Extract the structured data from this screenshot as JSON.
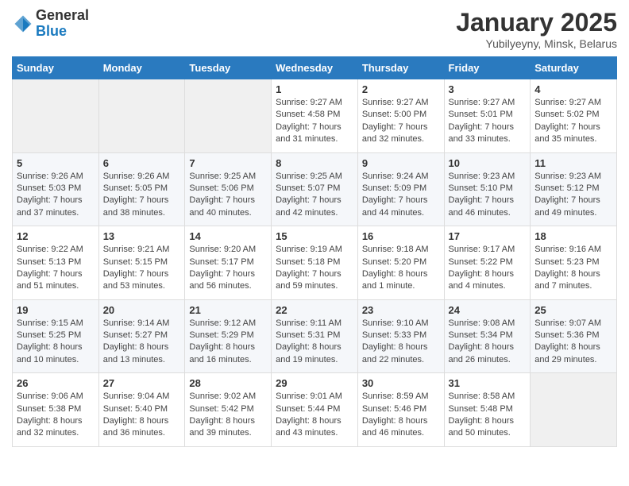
{
  "logo": {
    "general": "General",
    "blue": "Blue"
  },
  "header": {
    "title": "January 2025",
    "subtitle": "Yubilyeyny, Minsk, Belarus"
  },
  "weekdays": [
    "Sunday",
    "Monday",
    "Tuesday",
    "Wednesday",
    "Thursday",
    "Friday",
    "Saturday"
  ],
  "weeks": [
    [
      {
        "day": "",
        "content": ""
      },
      {
        "day": "",
        "content": ""
      },
      {
        "day": "",
        "content": ""
      },
      {
        "day": "1",
        "content": "Sunrise: 9:27 AM\nSunset: 4:58 PM\nDaylight: 7 hours and 31 minutes."
      },
      {
        "day": "2",
        "content": "Sunrise: 9:27 AM\nSunset: 5:00 PM\nDaylight: 7 hours and 32 minutes."
      },
      {
        "day": "3",
        "content": "Sunrise: 9:27 AM\nSunset: 5:01 PM\nDaylight: 7 hours and 33 minutes."
      },
      {
        "day": "4",
        "content": "Sunrise: 9:27 AM\nSunset: 5:02 PM\nDaylight: 7 hours and 35 minutes."
      }
    ],
    [
      {
        "day": "5",
        "content": "Sunrise: 9:26 AM\nSunset: 5:03 PM\nDaylight: 7 hours and 37 minutes."
      },
      {
        "day": "6",
        "content": "Sunrise: 9:26 AM\nSunset: 5:05 PM\nDaylight: 7 hours and 38 minutes."
      },
      {
        "day": "7",
        "content": "Sunrise: 9:25 AM\nSunset: 5:06 PM\nDaylight: 7 hours and 40 minutes."
      },
      {
        "day": "8",
        "content": "Sunrise: 9:25 AM\nSunset: 5:07 PM\nDaylight: 7 hours and 42 minutes."
      },
      {
        "day": "9",
        "content": "Sunrise: 9:24 AM\nSunset: 5:09 PM\nDaylight: 7 hours and 44 minutes."
      },
      {
        "day": "10",
        "content": "Sunrise: 9:23 AM\nSunset: 5:10 PM\nDaylight: 7 hours and 46 minutes."
      },
      {
        "day": "11",
        "content": "Sunrise: 9:23 AM\nSunset: 5:12 PM\nDaylight: 7 hours and 49 minutes."
      }
    ],
    [
      {
        "day": "12",
        "content": "Sunrise: 9:22 AM\nSunset: 5:13 PM\nDaylight: 7 hours and 51 minutes."
      },
      {
        "day": "13",
        "content": "Sunrise: 9:21 AM\nSunset: 5:15 PM\nDaylight: 7 hours and 53 minutes."
      },
      {
        "day": "14",
        "content": "Sunrise: 9:20 AM\nSunset: 5:17 PM\nDaylight: 7 hours and 56 minutes."
      },
      {
        "day": "15",
        "content": "Sunrise: 9:19 AM\nSunset: 5:18 PM\nDaylight: 7 hours and 59 minutes."
      },
      {
        "day": "16",
        "content": "Sunrise: 9:18 AM\nSunset: 5:20 PM\nDaylight: 8 hours and 1 minute."
      },
      {
        "day": "17",
        "content": "Sunrise: 9:17 AM\nSunset: 5:22 PM\nDaylight: 8 hours and 4 minutes."
      },
      {
        "day": "18",
        "content": "Sunrise: 9:16 AM\nSunset: 5:23 PM\nDaylight: 8 hours and 7 minutes."
      }
    ],
    [
      {
        "day": "19",
        "content": "Sunrise: 9:15 AM\nSunset: 5:25 PM\nDaylight: 8 hours and 10 minutes."
      },
      {
        "day": "20",
        "content": "Sunrise: 9:14 AM\nSunset: 5:27 PM\nDaylight: 8 hours and 13 minutes."
      },
      {
        "day": "21",
        "content": "Sunrise: 9:12 AM\nSunset: 5:29 PM\nDaylight: 8 hours and 16 minutes."
      },
      {
        "day": "22",
        "content": "Sunrise: 9:11 AM\nSunset: 5:31 PM\nDaylight: 8 hours and 19 minutes."
      },
      {
        "day": "23",
        "content": "Sunrise: 9:10 AM\nSunset: 5:33 PM\nDaylight: 8 hours and 22 minutes."
      },
      {
        "day": "24",
        "content": "Sunrise: 9:08 AM\nSunset: 5:34 PM\nDaylight: 8 hours and 26 minutes."
      },
      {
        "day": "25",
        "content": "Sunrise: 9:07 AM\nSunset: 5:36 PM\nDaylight: 8 hours and 29 minutes."
      }
    ],
    [
      {
        "day": "26",
        "content": "Sunrise: 9:06 AM\nSunset: 5:38 PM\nDaylight: 8 hours and 32 minutes."
      },
      {
        "day": "27",
        "content": "Sunrise: 9:04 AM\nSunset: 5:40 PM\nDaylight: 8 hours and 36 minutes."
      },
      {
        "day": "28",
        "content": "Sunrise: 9:02 AM\nSunset: 5:42 PM\nDaylight: 8 hours and 39 minutes."
      },
      {
        "day": "29",
        "content": "Sunrise: 9:01 AM\nSunset: 5:44 PM\nDaylight: 8 hours and 43 minutes."
      },
      {
        "day": "30",
        "content": "Sunrise: 8:59 AM\nSunset: 5:46 PM\nDaylight: 8 hours and 46 minutes."
      },
      {
        "day": "31",
        "content": "Sunrise: 8:58 AM\nSunset: 5:48 PM\nDaylight: 8 hours and 50 minutes."
      },
      {
        "day": "",
        "content": ""
      }
    ]
  ]
}
